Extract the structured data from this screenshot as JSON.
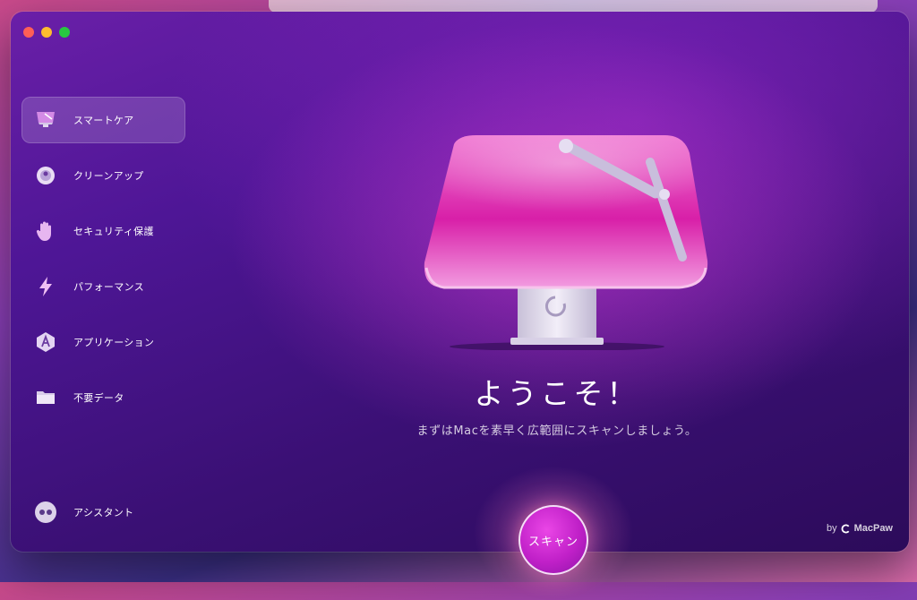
{
  "app": {
    "vendor_prefix": "by",
    "vendor_name": "MacPaw"
  },
  "sidebar": {
    "items": [
      {
        "label": "スマートケア",
        "icon": "smart-care-icon",
        "active": true
      },
      {
        "label": "クリーンアップ",
        "icon": "cleanup-icon",
        "active": false
      },
      {
        "label": "セキュリティ保護",
        "icon": "protection-hand-icon",
        "active": false
      },
      {
        "label": "パフォーマンス",
        "icon": "performance-bolt-icon",
        "active": false
      },
      {
        "label": "アプリケーション",
        "icon": "applications-icon",
        "active": false
      },
      {
        "label": "不要データ",
        "icon": "clutter-folder-icon",
        "active": false
      }
    ],
    "assistant_label": "アシスタント"
  },
  "main": {
    "welcome_title": "ようこそ！",
    "subtitle": "まずはMacを素早く広範囲にスキャンしましょう。",
    "scan_button_label": "スキャン"
  },
  "colors": {
    "accent": "#c020c8",
    "background": "#4e1696"
  }
}
